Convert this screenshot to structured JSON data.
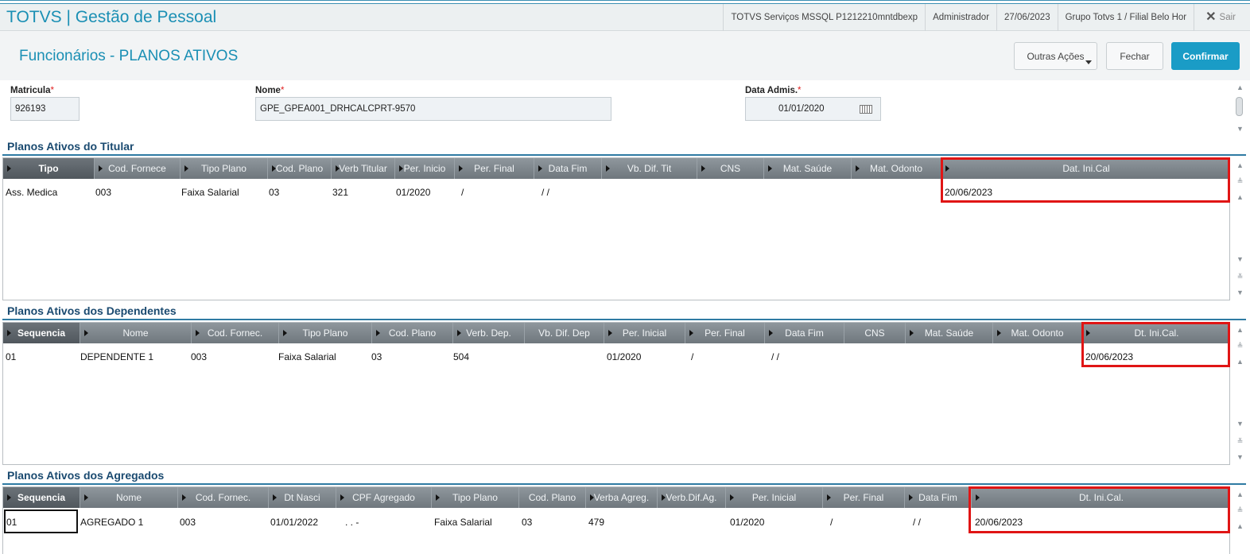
{
  "app": {
    "title": "TOTVS | Gestão de Pessoal",
    "server": "TOTVS Serviços MSSQL P1212210mntdbexp",
    "user": "Administrador",
    "date": "27/06/2023",
    "branch": "Grupo Totvs 1 / Filial Belo Hor",
    "logout_label": "Sair",
    "logout_icon": "close-icon"
  },
  "page": {
    "title": "Funcionários - PLANOS ATIVOS",
    "btn_more": "Outras Ações",
    "btn_close": "Fechar",
    "btn_confirm": "Confirmar",
    "accent": "#1a9cc6"
  },
  "form": {
    "matricula_label": "Matricula",
    "matricula_value": "926193",
    "nome_label": "Nome",
    "nome_value": "GPE_GPEA001_DRHCALCPRT-9570",
    "admis_label": "Data Admis.",
    "admis_value": "01/01/2020",
    "required_mark": "*"
  },
  "titular": {
    "title": "Planos Ativos do Titular",
    "headers": [
      "Tipo",
      "Cod. Fornece",
      "Tipo Plano",
      "Cod. Plano",
      "Verb Titular",
      "Per. Inicio",
      "Per. Final",
      "Data Fim",
      "Vb. Dif. Tit",
      "CNS",
      "Mat. Saúde",
      "Mat. Odonto",
      "Dat. Ini.Cal"
    ],
    "row": [
      "Ass. Medica",
      "003",
      "Faixa Salarial",
      "03",
      "321",
      "01/2020",
      "/",
      "/ /",
      "",
      "",
      "",
      "",
      "20/06/2023"
    ]
  },
  "dependentes": {
    "title": "Planos Ativos dos Dependentes",
    "headers": [
      "Sequencia",
      "Nome",
      "Cod. Fornec.",
      "Tipo Plano",
      "Cod. Plano",
      "Verb. Dep.",
      "Vb. Dif. Dep",
      "Per. Inicial",
      "Per. Final",
      "Data Fim",
      "CNS",
      "Mat. Saúde",
      "Mat. Odonto",
      "Dt. Ini.Cal."
    ],
    "row": [
      "01",
      "DEPENDENTE 1",
      "003",
      "Faixa Salarial",
      "03",
      "504",
      "",
      "01/2020",
      "/",
      "/ /",
      "",
      "",
      "",
      "20/06/2023"
    ]
  },
  "agregados": {
    "title": "Planos Ativos dos Agregados",
    "headers": [
      "Sequencia",
      "Nome",
      "Cod. Fornec.",
      "Dt Nasci",
      "CPF Agregado",
      "Tipo Plano",
      "Cod. Plano",
      "Verba Agreg.",
      "Verb.Dif.Ag.",
      "Per. Inicial",
      "Per. Final",
      "Data Fim",
      "Dt. Ini.Cal."
    ],
    "row": [
      "01",
      "AGREGADO 1",
      "003",
      "01/01/2022",
      ". . -",
      "Faixa Salarial",
      "03",
      "479",
      "",
      "01/2020",
      "/",
      "/ /",
      "20/06/2023"
    ]
  }
}
